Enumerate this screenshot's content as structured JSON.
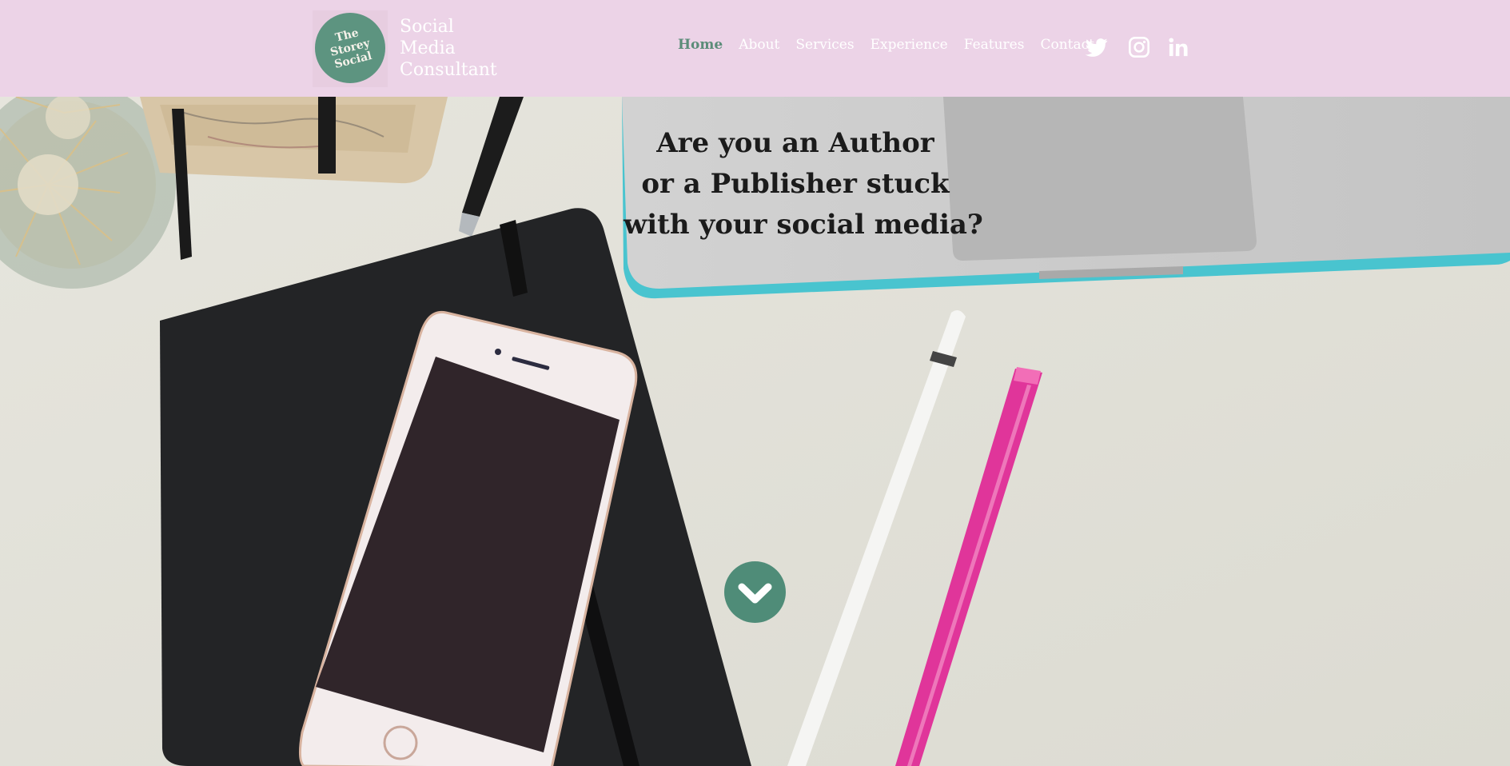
{
  "brand": {
    "logo_lines": [
      "The",
      "Storey",
      "Social"
    ],
    "title_lines": [
      "Social",
      "Media",
      "Consultant"
    ]
  },
  "nav": {
    "items": [
      {
        "label": "Home",
        "active": true
      },
      {
        "label": "About",
        "active": false
      },
      {
        "label": "Services",
        "active": false
      },
      {
        "label": "Experience",
        "active": false
      },
      {
        "label": "Features",
        "active": false
      },
      {
        "label": "Contact",
        "active": false
      }
    ]
  },
  "social": {
    "icons": [
      "twitter-icon",
      "instagram-icon",
      "linkedin-icon"
    ]
  },
  "hero": {
    "headline_lines": [
      "Are you an Author",
      "or a Publisher stuck",
      "with your social media?"
    ],
    "scroll_icon": "chevron-down-icon"
  },
  "colors": {
    "header_bg": "#ecd3e7",
    "accent_green": "#4f8c78",
    "nav_text": "#ffffff",
    "headline_text": "#1b1b1b"
  }
}
